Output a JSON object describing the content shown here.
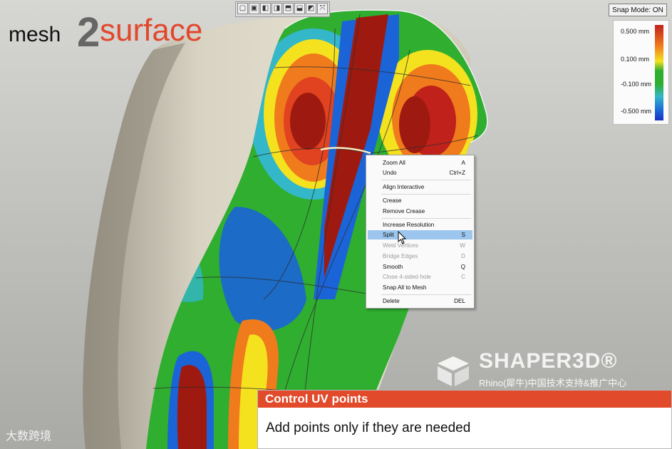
{
  "app": {
    "logo": {
      "part1": "mesh",
      "part2": "2",
      "part3": "surface"
    },
    "snap_mode": "Snap Mode: ON"
  },
  "toolbar": {
    "buttons": [
      "view-front",
      "view-back",
      "view-left",
      "view-right",
      "view-top",
      "view-bottom",
      "view-iso",
      "view-axes"
    ]
  },
  "legend": {
    "labels": [
      "0.500 mm",
      "0.100 mm",
      "-0.100 mm",
      "-0.500 mm"
    ],
    "colors": {
      "high": "#c0221b",
      "mid": "#2fae2f",
      "low": "#1a2fc3"
    }
  },
  "context_menu": {
    "items": [
      {
        "label": "Zoom All",
        "key": "A",
        "state": "normal"
      },
      {
        "label": "Undo",
        "key": "Ctrl+Z",
        "state": "normal"
      },
      {
        "label": "Align Interactive",
        "key": "",
        "state": "normal"
      },
      {
        "label": "Crease",
        "key": "",
        "state": "normal"
      },
      {
        "label": "Remove Crease",
        "key": "",
        "state": "normal"
      },
      {
        "label": "Increase Resolution",
        "key": "",
        "state": "normal"
      },
      {
        "label": "Split",
        "key": "S",
        "state": "selected"
      },
      {
        "label": "Weld Vertices",
        "key": "W",
        "state": "disabled"
      },
      {
        "label": "Bridge Edges",
        "key": "D",
        "state": "disabled"
      },
      {
        "label": "Smooth",
        "key": "Q",
        "state": "normal"
      },
      {
        "label": "Close 4-sided hole",
        "key": "C",
        "state": "disabled"
      },
      {
        "label": "Snap All to Mesh",
        "key": "",
        "state": "normal"
      },
      {
        "label": "Delete",
        "key": "DEL",
        "state": "normal"
      }
    ]
  },
  "watermark": {
    "brand": "SHAPER3D®",
    "subtitle": "Rhino(犀牛)中国技术支持&推广中心",
    "corner": "大数跨境"
  },
  "caption": {
    "title": "Control UV points",
    "text": "Add points only if they are needed"
  }
}
